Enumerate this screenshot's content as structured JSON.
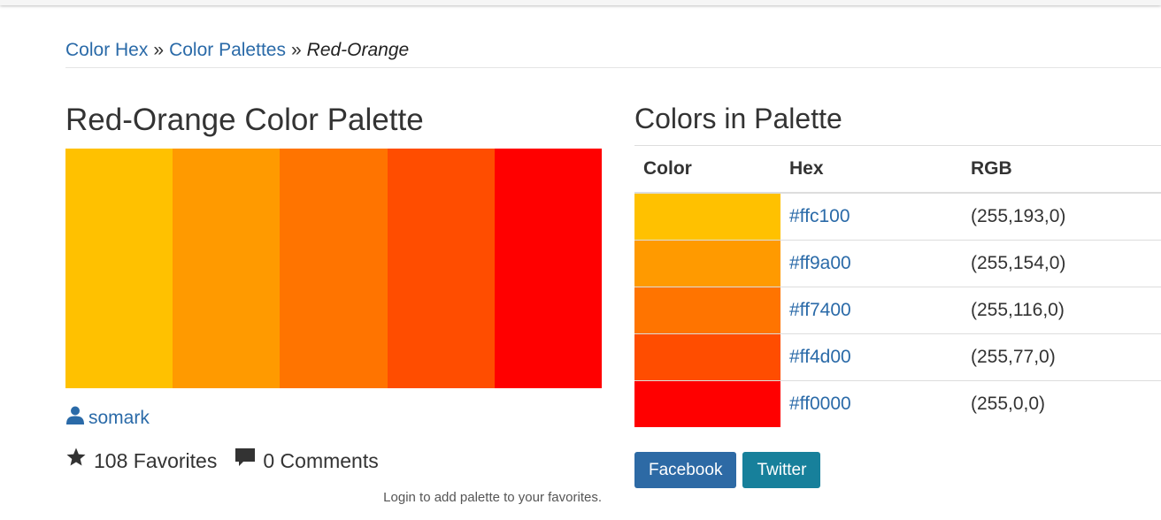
{
  "breadcrumb": {
    "home": "Color Hex",
    "palettes": "Color Palettes",
    "separator": "»",
    "current": "Red-Orange"
  },
  "palette": {
    "title": "Red-Orange Color Palette",
    "colors": [
      "#ffc100",
      "#ff9a00",
      "#ff7400",
      "#ff4d00",
      "#ff0000"
    ],
    "author": "somark",
    "favorites": "108 Favorites",
    "comments": "0 Comments",
    "login_note": "Login to add palette to your favorites."
  },
  "table": {
    "title": "Colors in Palette",
    "headers": {
      "color": "Color",
      "hex": "Hex",
      "rgb": "RGB"
    },
    "rows": [
      {
        "hex": "#ffc100",
        "rgb": "(255,193,0)"
      },
      {
        "hex": "#ff9a00",
        "rgb": "(255,154,0)"
      },
      {
        "hex": "#ff7400",
        "rgb": "(255,116,0)"
      },
      {
        "hex": "#ff4d00",
        "rgb": "(255,77,0)"
      },
      {
        "hex": "#ff0000",
        "rgb": "(255,0,0)"
      }
    ]
  },
  "share": {
    "facebook": "Facebook",
    "twitter": "Twitter"
  },
  "colors": {
    "link": "#2a6aa8",
    "facebook": "#2d6aa5",
    "twitter": "#17809b"
  },
  "icons": {
    "author": "user-icon",
    "favorites": "star-icon",
    "comments": "comment-icon"
  }
}
